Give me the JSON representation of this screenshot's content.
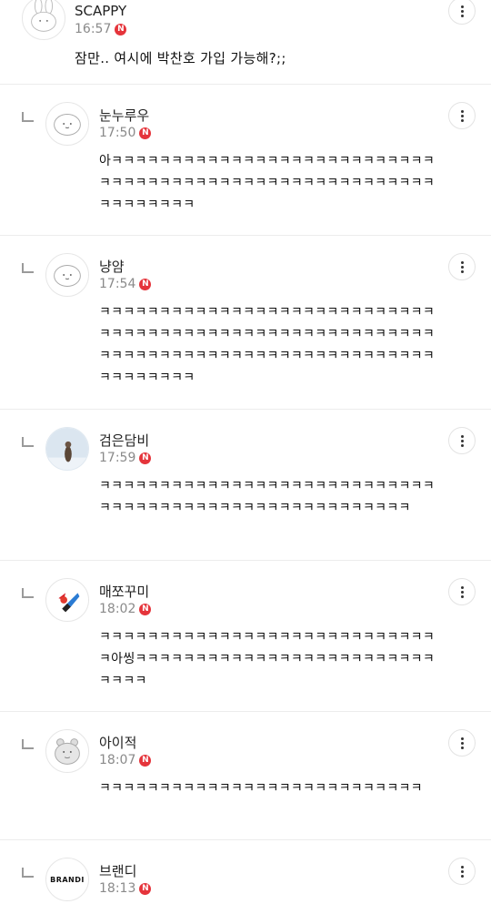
{
  "comments": [
    {
      "name": "SCAPPY",
      "time": "16:57",
      "badge": "N",
      "text": "잠만.. 여시에 박찬호 가입 가능해?;;",
      "avatar_icon": "bunny-avatar-icon"
    },
    {
      "name": "눈누루우",
      "time": "17:50",
      "badge": "N",
      "text": "아ㅋㅋㅋㅋㅋㅋㅋㅋㅋㅋㅋㅋㅋㅋㅋㅋㅋㅋㅋㅋㅋㅋㅋㅋㅋㅋㅋㅋㅋㅋㅋㅋㅋㅋㅋㅋㅋㅋㅋㅋㅋㅋㅋㅋㅋㅋㅋㅋㅋㅋㅋㅋㅋㅋㅋㅋㅋㅋㅋㅋㅋㅋㅋ",
      "avatar_icon": "blob-avatar-icon"
    },
    {
      "name": "냥얌",
      "time": "17:54",
      "badge": "N",
      "text": "ㅋㅋㅋㅋㅋㅋㅋㅋㅋㅋㅋㅋㅋㅋㅋㅋㅋㅋㅋㅋㅋㅋㅋㅋㅋㅋㅋㅋㅋㅋㅋㅋㅋㅋㅋㅋㅋㅋㅋㅋㅋㅋㅋㅋㅋㅋㅋㅋㅋㅋㅋㅋㅋㅋㅋㅋㅋㅋㅋㅋㅋㅋㅋㅋㅋㅋㅋㅋㅋㅋㅋㅋㅋㅋㅋㅋㅋㅋㅋㅋㅋㅋㅋㅋㅋㅋㅋㅋㅋㅋㅋㅋ",
      "avatar_icon": "blob-avatar-icon"
    },
    {
      "name": "검은담비",
      "time": "17:59",
      "badge": "N",
      "text": "ㅋㅋㅋㅋㅋㅋㅋㅋㅋㅋㅋㅋㅋㅋㅋㅋㅋㅋㅋㅋㅋㅋㅋㅋㅋㅋㅋㅋㅋㅋㅋㅋㅋㅋㅋㅋㅋㅋㅋㅋㅋㅋㅋㅋㅋㅋㅋㅋㅋㅋㅋㅋㅋㅋ",
      "avatar_icon": "sable-photo-avatar-icon"
    },
    {
      "name": "매쪼꾸미",
      "time": "18:02",
      "badge": "N",
      "text": "ㅋㅋㅋㅋㅋㅋㅋㅋㅋㅋㅋㅋㅋㅋㅋㅋㅋㅋㅋㅋㅋㅋㅋㅋㅋㅋㅋㅋㅋ아씽ㅋㅋㅋㅋㅋㅋㅋㅋㅋㅋㅋㅋㅋㅋㅋㅋㅋㅋㅋㅋㅋㅋㅋㅋㅋㅋㅋㅋㅋ",
      "avatar_icon": "cartoon-avatar-icon"
    },
    {
      "name": "아이적",
      "time": "18:07",
      "badge": "N",
      "text": "ㅋㅋㅋㅋㅋㅋㅋㅋㅋㅋㅋㅋㅋㅋㅋㅋㅋㅋㅋㅋㅋㅋㅋㅋㅋㅋㅋ",
      "avatar_icon": "hamster-avatar-icon"
    },
    {
      "name": "브랜디",
      "time": "18:13",
      "badge": "N",
      "text": "",
      "avatar_icon": "brandi-logo-avatar-icon",
      "avatar_text": "BRANDI"
    }
  ],
  "colors": {
    "badge": "#e5343b",
    "divider": "#ececec",
    "time": "#8a8a8a"
  },
  "more_icon": "more-vertical-icon"
}
